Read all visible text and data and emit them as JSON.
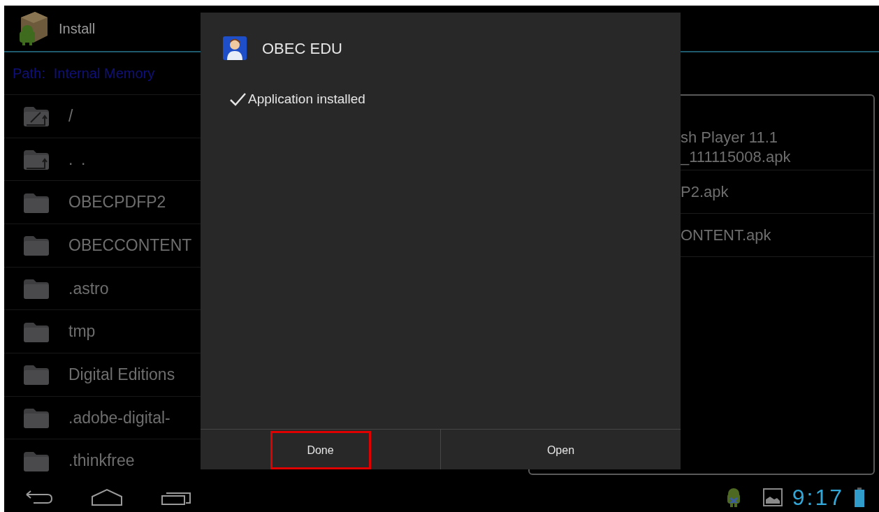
{
  "app_bar": {
    "title": "Install"
  },
  "path": {
    "label": "Path:",
    "value": "Internal Memory"
  },
  "files": [
    {
      "kind": "root",
      "name": "/"
    },
    {
      "kind": "up",
      "name": ".."
    },
    {
      "kind": "folder",
      "name": "OBECPDFP2"
    },
    {
      "kind": "folder",
      "name": "OBECCONTENT"
    },
    {
      "kind": "folder",
      "name": ".astro"
    },
    {
      "kind": "folder",
      "name": "tmp"
    },
    {
      "kind": "folder",
      "name": "Digital Editions"
    },
    {
      "kind": "folder",
      "name": ".adobe-digital-"
    },
    {
      "kind": "folder",
      "name": ".thinkfree"
    }
  ],
  "side_panel": {
    "items": [
      {
        "lines": [
          "sh Player 11.1",
          "_111115008.apk"
        ]
      },
      {
        "lines": [
          "P2.apk"
        ]
      },
      {
        "lines": [
          "ONTENT.apk"
        ]
      }
    ]
  },
  "dialog": {
    "title": "OBEC EDU",
    "message": "Application installed",
    "buttons": [
      {
        "label": "Done",
        "highlighted": true
      },
      {
        "label": "Open",
        "highlighted": false
      }
    ]
  },
  "status_bar": {
    "time": "9:17"
  }
}
